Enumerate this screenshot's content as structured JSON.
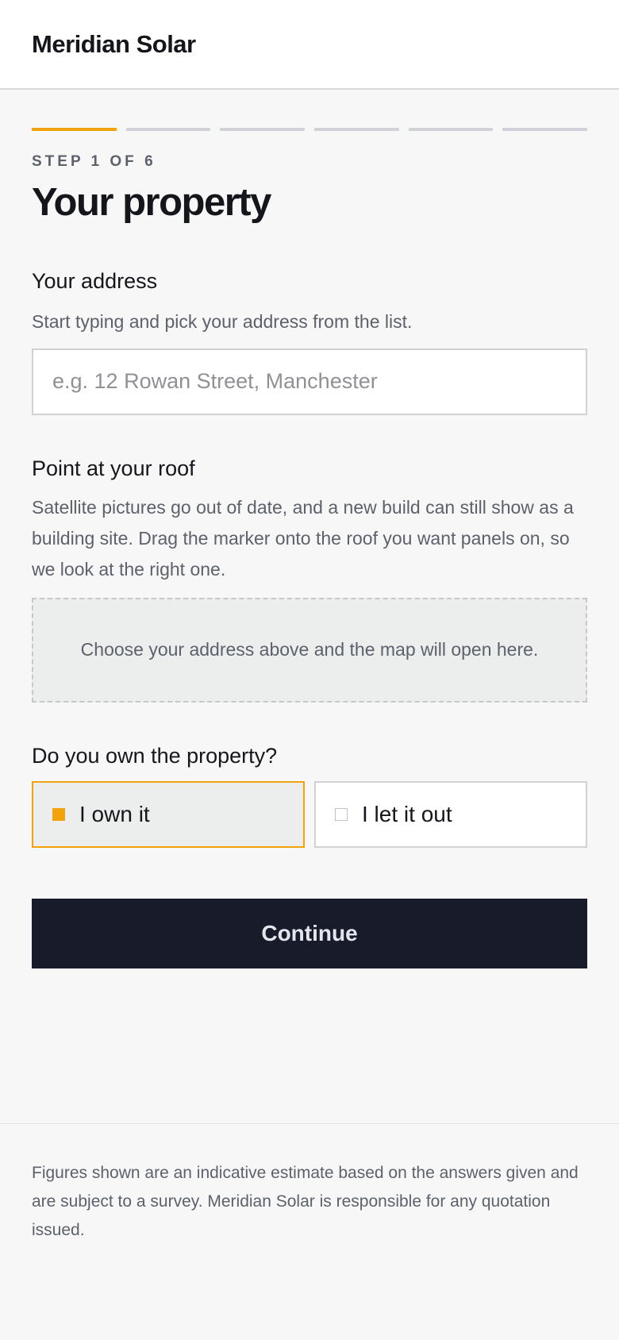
{
  "header": {
    "brand": "Meridian Solar"
  },
  "progress": {
    "current_step": 1,
    "total_steps": 6,
    "step_label": "STEP 1 OF 6"
  },
  "page": {
    "title": "Your property"
  },
  "address": {
    "heading": "Your address",
    "hint": "Start typing and pick your address from the list.",
    "value": "",
    "placeholder": "e.g. 12 Rowan Street, Manchester"
  },
  "roof": {
    "heading": "Point at your roof",
    "hint": "Satellite pictures go out of date, and a new build can still show as a building site. Drag the marker onto the roof you want panels on, so we look at the right one.",
    "map_message": "Choose your address above and the map will open here."
  },
  "ownership": {
    "heading": "Do you own the property?",
    "options": [
      {
        "label": "I own it",
        "selected": true
      },
      {
        "label": "I let it out",
        "selected": false
      }
    ]
  },
  "actions": {
    "continue_label": "Continue"
  },
  "footer": {
    "disclaimer": "Figures shown are an indicative estimate based on the answers given and are subject to a survey. Meridian Solar is responsible for any quotation issued."
  },
  "colors": {
    "accent": "#f2a20c",
    "button": "#181b2a",
    "muted_text": "#5c616b"
  }
}
